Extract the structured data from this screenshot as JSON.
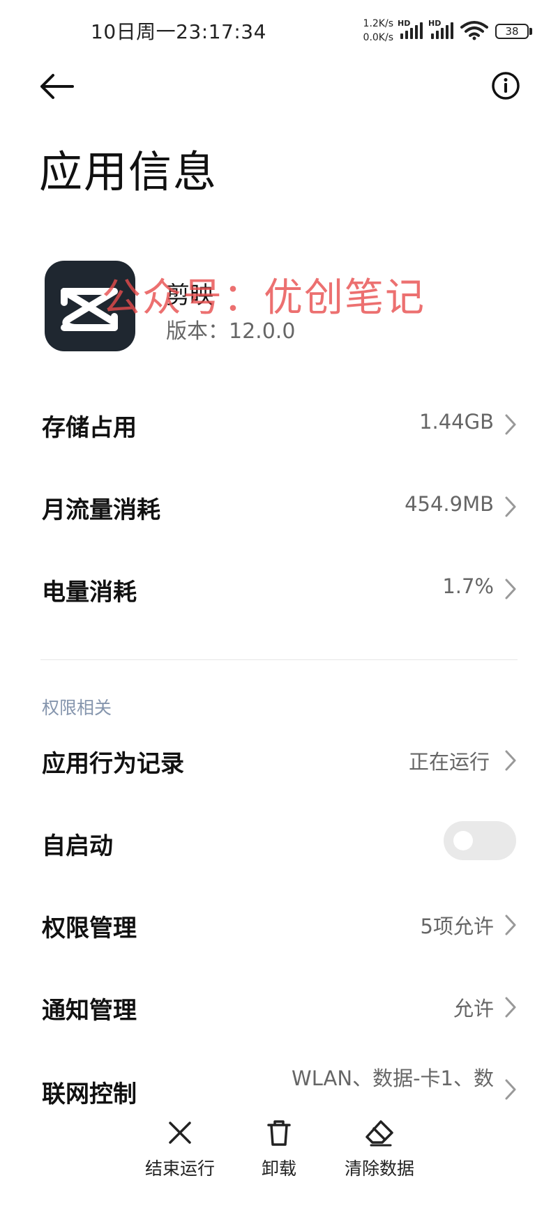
{
  "status_bar": {
    "time": "10日周一23:17:34",
    "net_up": "1.2K/s",
    "net_down": "0.0K/s",
    "hd1": "HD",
    "hd2": "HD",
    "battery": "38"
  },
  "header": {
    "back_icon": "arrow-left-icon",
    "info_icon": "info-circle-icon",
    "title": "应用信息"
  },
  "app": {
    "name": "剪映",
    "version": "版本：12.0.0",
    "watermark": "公众号：优创笔记"
  },
  "rows": [
    {
      "label": "存储占用",
      "value": "1.44GB"
    },
    {
      "label": "月流量消耗",
      "value": "454.9MB"
    },
    {
      "label": "电量消耗",
      "value": "1.7%"
    }
  ],
  "permissions": {
    "section_title": "权限相关",
    "items": [
      {
        "label": "应用行为记录",
        "value": "正在运行"
      },
      {
        "label": "自启动",
        "toggle_on": false
      },
      {
        "label": "权限管理",
        "value": "5项允许"
      },
      {
        "label": "通知管理",
        "value": "允许"
      },
      {
        "label": "联网控制",
        "value": "WLAN、数据-卡1、数"
      }
    ]
  },
  "bottom_actions": [
    {
      "label": "结束运行",
      "icon": "close-x-icon"
    },
    {
      "label": "卸载",
      "icon": "trash-icon"
    },
    {
      "label": "清除数据",
      "icon": "eraser-icon"
    }
  ],
  "colors": {
    "icon_bg": "#1f2730",
    "section_header": "#8595ad",
    "watermark": "#e74c4c"
  }
}
